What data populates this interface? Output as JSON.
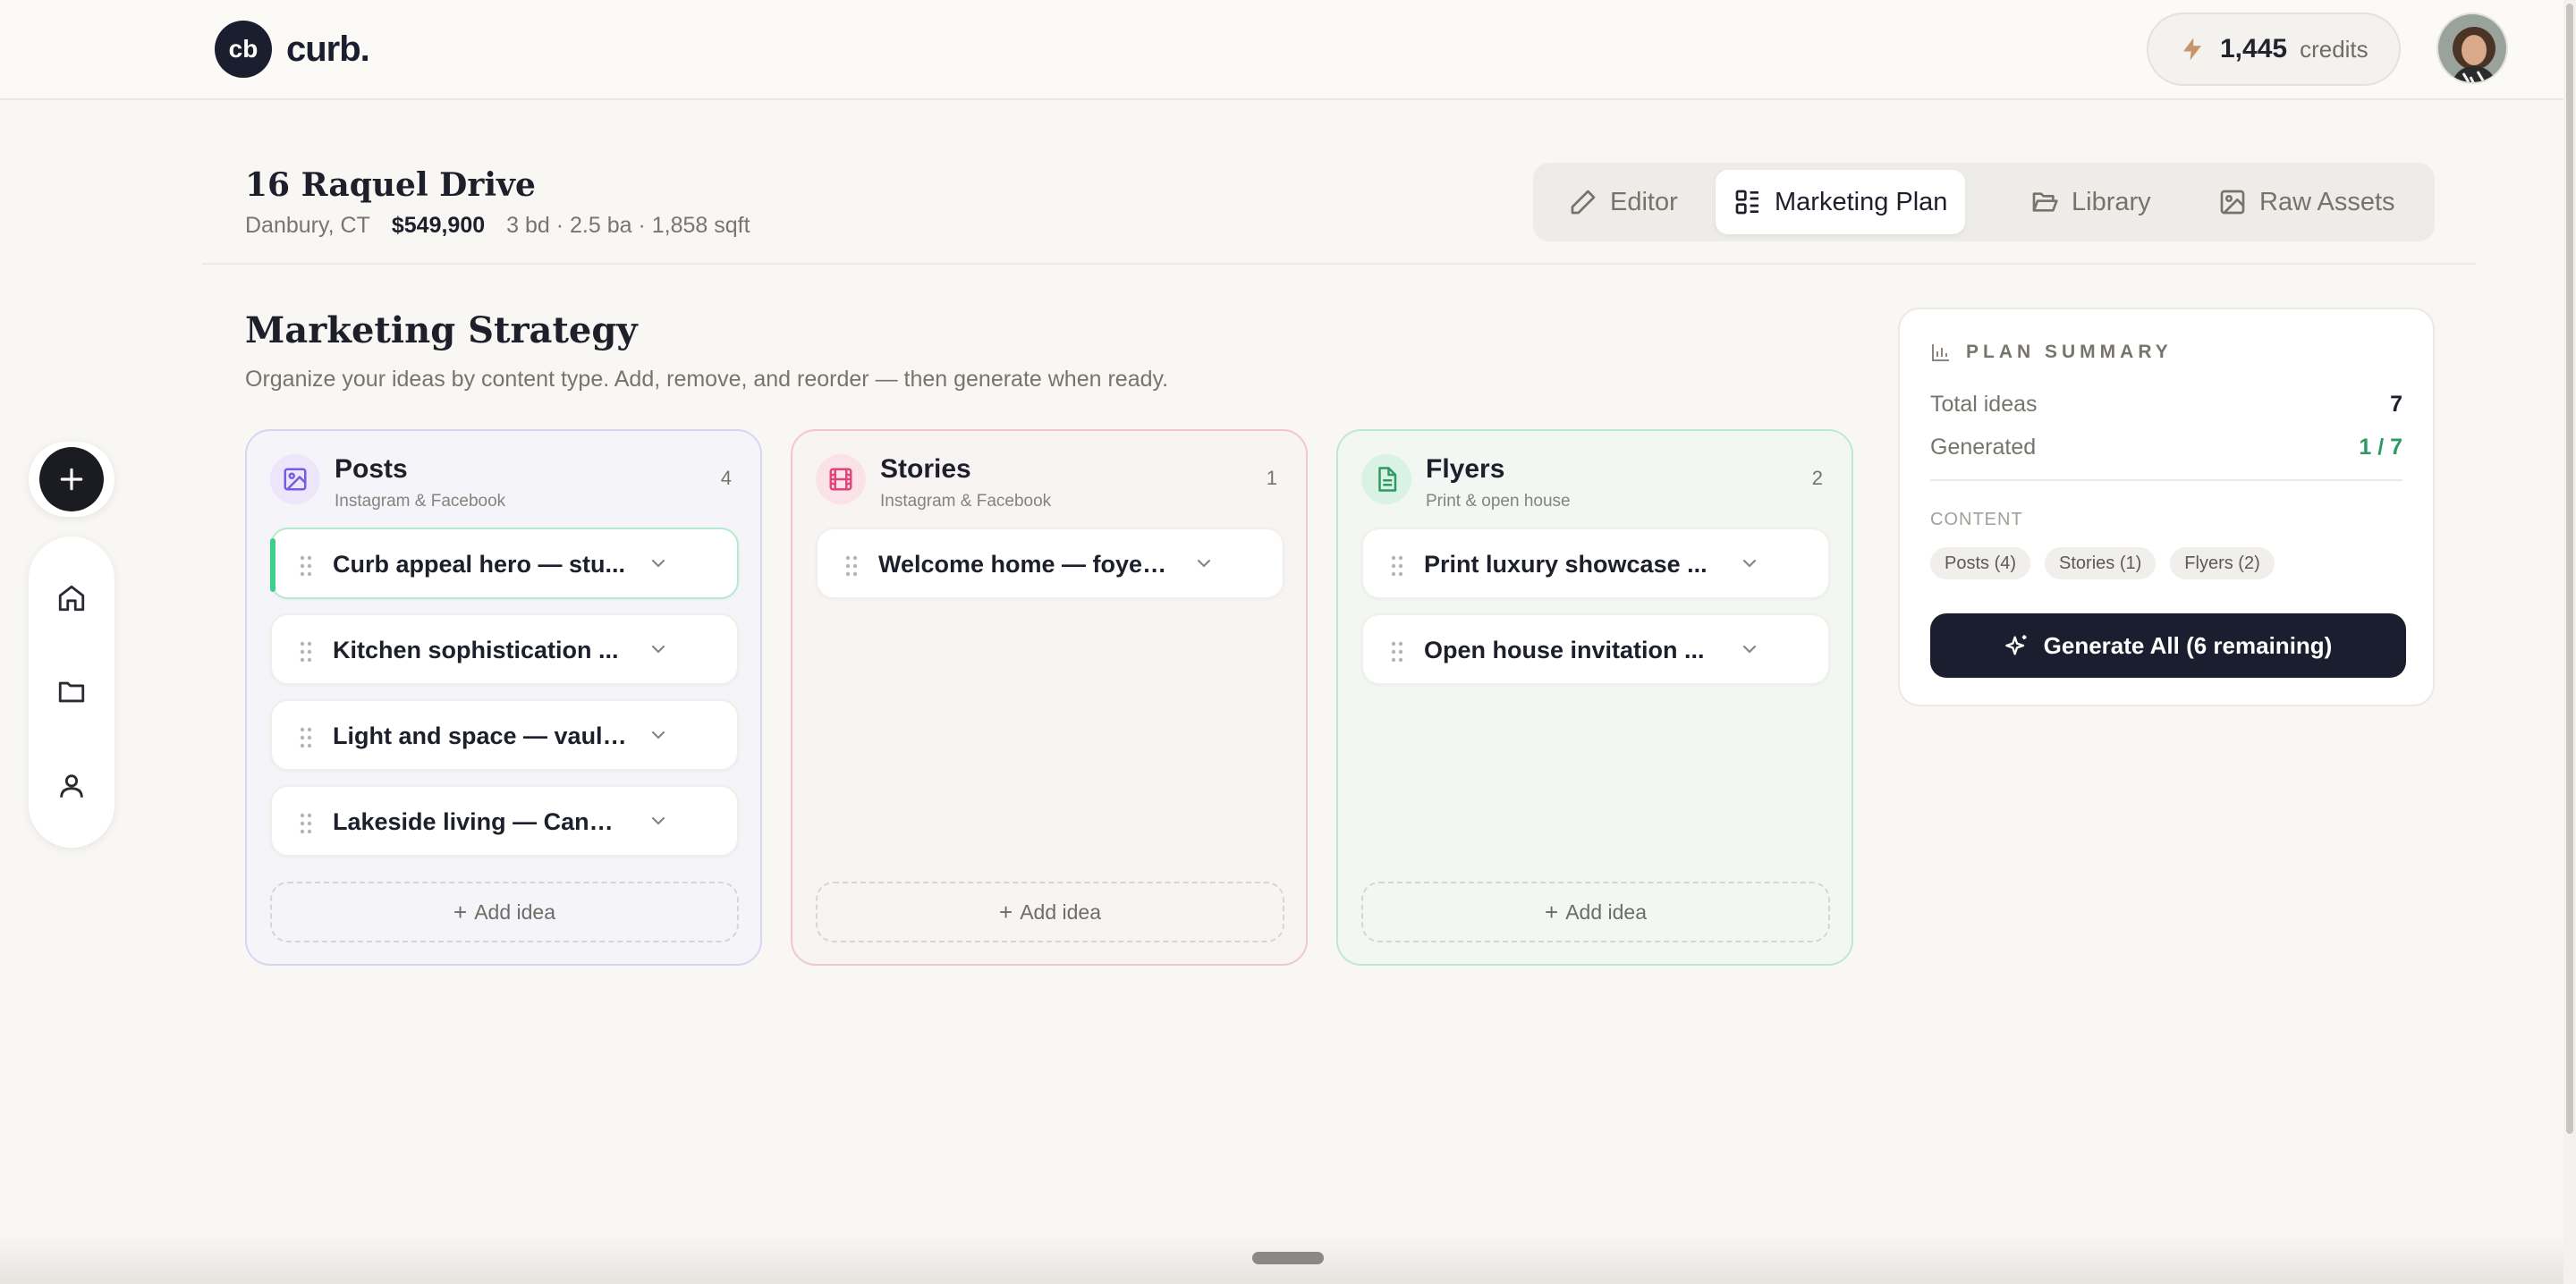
{
  "app": {
    "logo_mark": "cb",
    "logo_text": "curb.",
    "credits_value": "1,445",
    "credits_label": "credits",
    "credits_icon": "bolt-icon",
    "avatar": "user-avatar"
  },
  "property": {
    "address": "16 Raquel Drive",
    "city": "Danbury, CT",
    "price": "$549,900",
    "specs": "3 bd · 2.5 ba · 1,858 sqft"
  },
  "tabs": [
    {
      "label": "Editor",
      "icon": "pencil-icon",
      "active": false
    },
    {
      "label": "Marketing Plan",
      "icon": "layout-list-icon",
      "active": true
    },
    {
      "label": "Library",
      "icon": "folder-open-icon",
      "active": false
    },
    {
      "label": "Raw Assets",
      "icon": "image-icon",
      "active": false
    }
  ],
  "strategy": {
    "title": "Marketing Strategy",
    "subtitle": "Organize your ideas by content type. Add, remove, and reorder — then generate when ready."
  },
  "columns": {
    "posts": {
      "name": "Posts",
      "desc": "Instagram & Facebook",
      "count": "4",
      "items": [
        "Curb appeal hero — stu...",
        "Kitchen sophistication ...",
        "Light and space — vault...",
        "Lakeside living — Candl..."
      ],
      "add_label": "Add idea"
    },
    "stories": {
      "name": "Stories",
      "desc": "Instagram & Facebook",
      "count": "1",
      "items": [
        "Welcome home — foyer ..."
      ],
      "add_label": "Add idea"
    },
    "flyers": {
      "name": "Flyers",
      "desc": "Print & open house",
      "count": "2",
      "items": [
        "Print luxury showcase ...",
        "Open house invitation ..."
      ],
      "add_label": "Add idea"
    }
  },
  "summary": {
    "title": "PLAN SUMMARY",
    "total_label": "Total ideas",
    "total_value": "7",
    "generated_label": "Generated",
    "generated_value": "1 / 7",
    "content_label": "CONTENT",
    "chips": [
      "Posts (4)",
      "Stories (1)",
      "Flyers (2)"
    ],
    "button_label": "Generate All (6 remaining)"
  },
  "colors": {
    "brand_dark": "#1b1e2e",
    "accent_green": "#2e9a63",
    "posts_accent": "#7a5be0",
    "stories_accent": "#e0457a",
    "flyers_accent": "#2e9a63"
  }
}
